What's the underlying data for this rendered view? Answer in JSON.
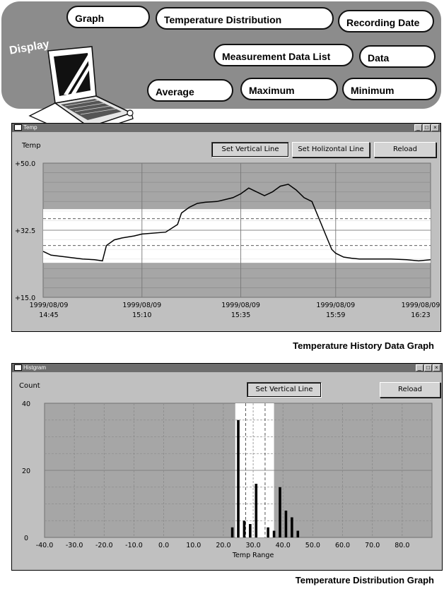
{
  "banner": {
    "display_label": "Display",
    "buttons": {
      "graph": "Graph",
      "temperature_distribution": "Temperature Distribution",
      "recording_date": "Recording Date",
      "measurement_data_list": "Measurement Data List",
      "data": "Data",
      "average": "Average",
      "maximum": "Maximum",
      "minimum": "Minimum"
    }
  },
  "history_window": {
    "title": "Temp",
    "y_label": "Temp",
    "buttons": {
      "set_vertical_line": "Set Vertical Line",
      "set_horizontal_line": "Set Holizontal Line",
      "reload": "Reload"
    },
    "caption": "Temperature History Data Graph"
  },
  "histogram_window": {
    "title": "Histgram",
    "y_label": "Count",
    "buttons": {
      "set_vertical_line": "Set Vertical Line",
      "reload": "Reload"
    },
    "caption": "Temperature Distribution Graph"
  },
  "chart_data": [
    {
      "type": "line",
      "ylabel": "Temp",
      "ylim": [
        15.0,
        50.0
      ],
      "y_ticks": [
        {
          "value": 50.0,
          "label": "+50.0"
        },
        {
          "value": 32.5,
          "label": "+32.5"
        },
        {
          "value": 15.0,
          "label": "+15.0"
        }
      ],
      "x_ticks": [
        {
          "date": "1999/08/09",
          "time": "14:45"
        },
        {
          "date": "1999/08/09",
          "time": "15:10"
        },
        {
          "date": "1999/08/09",
          "time": "15:35"
        },
        {
          "date": "1999/08/09",
          "time": "15:59"
        },
        {
          "date": "1999/08/09",
          "time": "16:23"
        }
      ],
      "band": [
        24.0,
        38.0
      ],
      "dashed_lines": [
        35.5,
        28.5
      ],
      "series": [
        {
          "x": [
            "14:45",
            "14:47",
            "14:51",
            "14:55",
            "14:58",
            "15:00",
            "15:01",
            "15:03",
            "15:05",
            "15:08",
            "15:10",
            "15:16",
            "15:19",
            "15:20",
            "15:22",
            "15:24",
            "15:26",
            "15:29",
            "15:31",
            "15:33",
            "15:35",
            "15:37",
            "15:39",
            "15:41",
            "15:43",
            "15:45",
            "15:47",
            "15:49",
            "15:51",
            "15:53",
            "15:55",
            "15:57",
            "15:58",
            "15:59",
            "16:01",
            "16:03",
            "16:05",
            "16:09",
            "16:13",
            "16:17",
            "16:20",
            "16:23"
          ],
          "y": [
            27.0,
            26.0,
            25.5,
            25.0,
            24.8,
            24.5,
            28.5,
            30.0,
            30.5,
            31.0,
            31.5,
            32.0,
            34.0,
            37.0,
            38.5,
            39.5,
            39.8,
            40.0,
            40.5,
            41.0,
            42.0,
            43.5,
            42.5,
            41.5,
            42.5,
            44.0,
            44.5,
            43.0,
            41.0,
            40.0,
            35.0,
            30.0,
            27.5,
            26.5,
            25.5,
            25.2,
            25.0,
            25.0,
            25.0,
            24.8,
            24.5,
            24.8
          ]
        }
      ]
    },
    {
      "type": "bar",
      "xlabel": "Temp Range",
      "ylabel": "Count",
      "xlim": [
        -40,
        90
      ],
      "ylim": [
        0,
        40
      ],
      "x_ticks": [
        {
          "value": -40,
          "label": "-40.0"
        },
        {
          "value": -30,
          "label": "-30.0"
        },
        {
          "value": -20,
          "label": "-20.0"
        },
        {
          "value": -10,
          "label": "-10.0"
        },
        {
          "value": 0,
          "label": "0.0"
        },
        {
          "value": 10,
          "label": "10.0"
        },
        {
          "value": 20,
          "label": "20.0"
        },
        {
          "value": 30,
          "label": "30.0"
        },
        {
          "value": 40,
          "label": "40.0"
        },
        {
          "value": 50,
          "label": "50.0"
        },
        {
          "value": 60,
          "label": "60.0"
        },
        {
          "value": 70,
          "label": "70.0"
        },
        {
          "value": 80,
          "label": "80.0"
        }
      ],
      "y_ticks": [
        {
          "value": 40,
          "label": "40"
        },
        {
          "value": 20,
          "label": "20"
        },
        {
          "value": 0,
          "label": "0"
        }
      ],
      "band": [
        24.0,
        37.0
      ],
      "dashed_lines": [
        27.5,
        34.0
      ],
      "x": [
        23,
        25,
        27,
        29,
        31,
        35,
        37,
        39,
        41,
        43,
        45
      ],
      "values": [
        3,
        35,
        5,
        4,
        16,
        3,
        2,
        15,
        8,
        6,
        2
      ]
    }
  ],
  "colors": {
    "banner": "#8c8c8c",
    "window": "#c0c0c0",
    "plot_bg": "#a6a6a6",
    "band": "#ffffff",
    "line": "#000000"
  }
}
